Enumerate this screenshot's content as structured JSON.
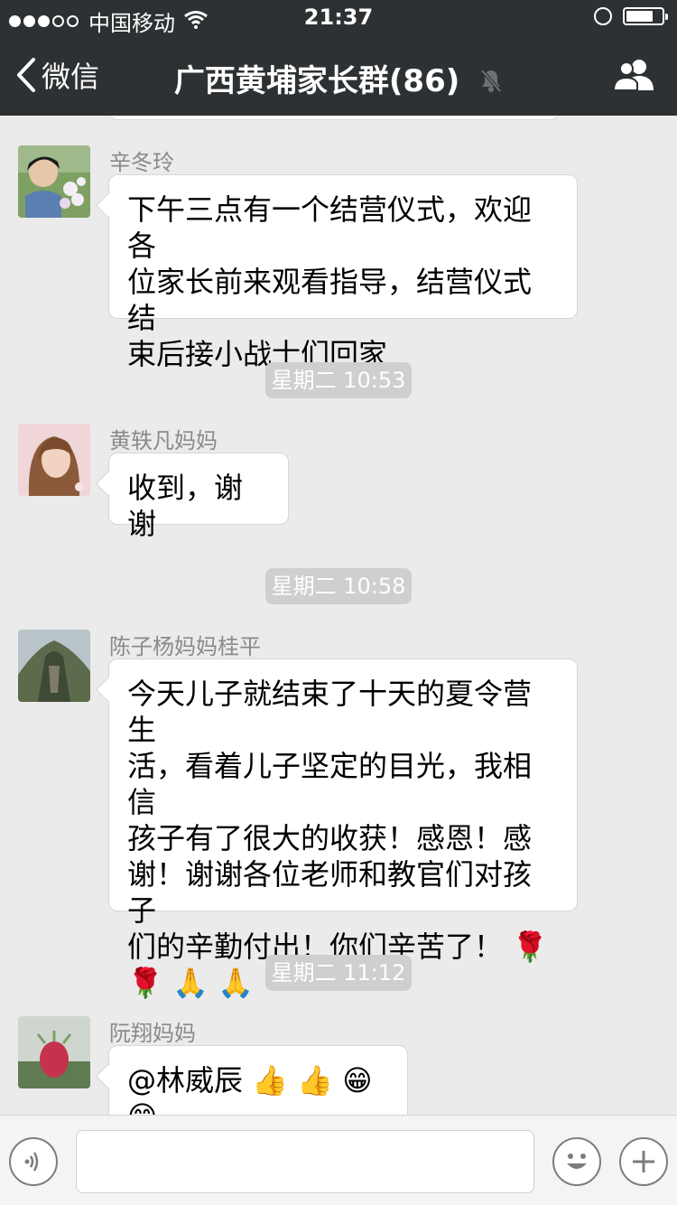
{
  "status_bar": {
    "carrier": "中国移动",
    "time": "21:37",
    "battery_level": 0.75
  },
  "nav": {
    "back_label": "微信",
    "title": "广西黄埔家长群(86)"
  },
  "messages": [
    {
      "sender": "辛冬玲",
      "text": "下午三点有一个结营仪式，欢迎各位家长前来观看指导，结营仪式结束后接小战士们回家",
      "lines": [
        "下午三点有一个结营仪式，欢迎各",
        "位家长前来观看指导，结营仪式结",
        "束后接小战士们回家"
      ]
    },
    {
      "timestamp": "星期二 10:53",
      "sender": "黄轶凡妈妈",
      "text": "收到，谢谢"
    },
    {
      "timestamp": "星期二 10:58",
      "sender": "陈子杨妈妈桂平",
      "lines": [
        "今天儿子就结束了十天的夏令营生",
        "活，看着儿子坚定的目光，我相信",
        "孩子有了很大的收获！感恩！感",
        "谢！谢谢各位老师和教官们对孩子",
        "们的辛勤付出！你们辛苦了！"
      ],
      "emojis_line5": "🌹",
      "emojis_line6": "🌹 🙏 🙏"
    },
    {
      "timestamp": "星期二 11:12",
      "sender": "阮翔妈妈",
      "text": "@林威辰",
      "emojis": "👍 👍 😁 😁"
    }
  ],
  "input_bar": {
    "voice_icon": "voice-icon",
    "emoji_icon": "emoji-icon",
    "plus_icon": "plus-icon"
  },
  "colors": {
    "nav_bg": "#2e3133",
    "chat_bg": "#ebebeb",
    "timestamp_bg": "#cfcfcf"
  }
}
